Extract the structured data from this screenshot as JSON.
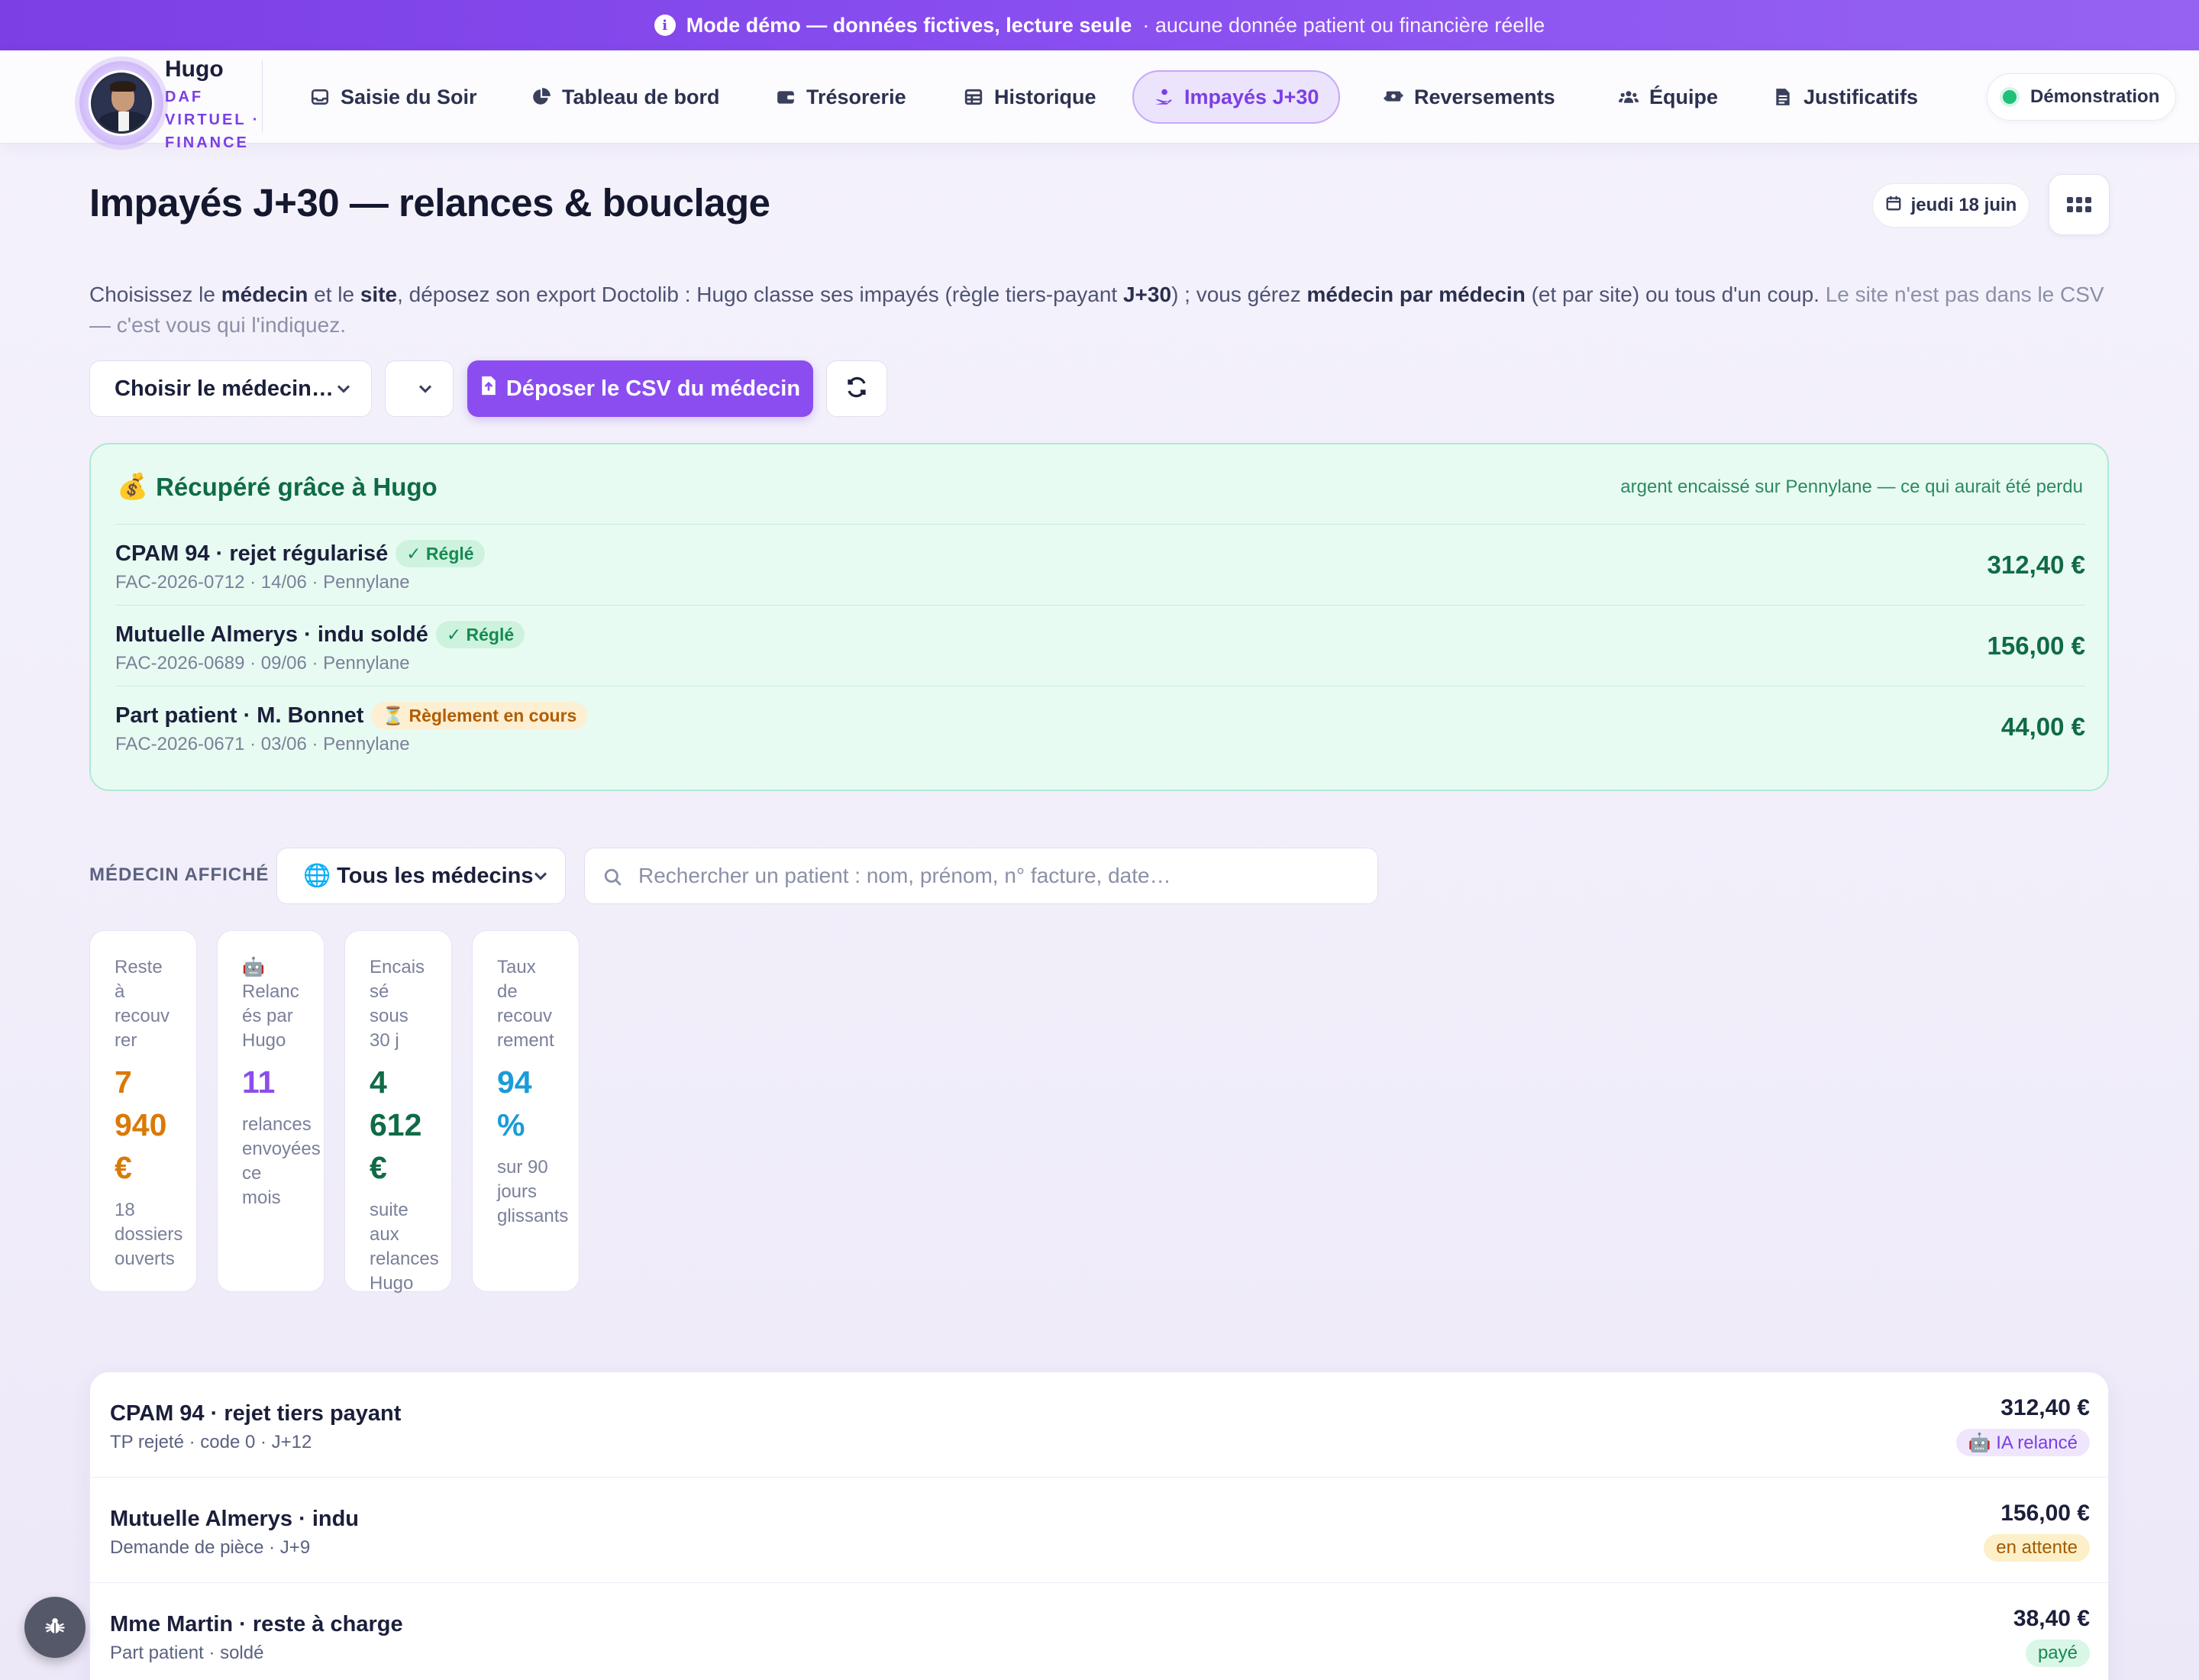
{
  "banner": {
    "title": "Mode démo — données fictives, lecture seule",
    "subtitle": "· aucune donnée patient ou financière réelle",
    "icon": "info-icon"
  },
  "brand": {
    "name": "Hugo",
    "tagline": "DAF VIRTUEL · FINANCE"
  },
  "nav": {
    "items": [
      {
        "label": "Saisie du Soir",
        "icon": "inbox-icon"
      },
      {
        "label": "Tableau de bord",
        "icon": "pie-chart-icon"
      },
      {
        "label": "Trésorerie",
        "icon": "wallet-icon"
      },
      {
        "label": "Historique",
        "icon": "table-icon"
      },
      {
        "label": "Impayés J+30",
        "icon": "hand-coins-icon",
        "active": true
      },
      {
        "label": "Reversements",
        "icon": "money-transfer-icon"
      },
      {
        "label": "Équipe",
        "icon": "users-icon"
      },
      {
        "label": "Justificatifs",
        "icon": "document-icon"
      }
    ],
    "mode_pill": "Démonstration"
  },
  "header": {
    "title": "Impayés J+30 — relances & bouclage",
    "date": "jeudi 18 juin"
  },
  "intro": {
    "p1": "Choisissez le ",
    "b1": "médecin",
    "p2": " et le ",
    "b2": "site",
    "p3": ", déposez son export Doctolib : Hugo classe ses impayés (règle tiers-payant ",
    "b3": "J+30",
    "p4": ") ; vous gérez ",
    "b4": "médecin par médecin",
    "p5": " (et par site) ou tous d'un coup. ",
    "muted": "Le site n'est pas dans le CSV — c'est vous qui l'indiquez."
  },
  "controls": {
    "doctor_select": "Choisir le médecin…",
    "site_select": "",
    "upload_button": "Déposer le CSV du médecin"
  },
  "recovered": {
    "title": "Récupéré grâce à Hugo",
    "title_emoji": "💰",
    "note": "argent encaissé sur Pennylane — ce qui aurait été perdu",
    "rows": [
      {
        "title": "CPAM 94 · rejet régularisé",
        "badge": "✓ Réglé",
        "badge_type": "ok",
        "sub": "FAC-2026-0712 · 14/06 · Pennylane",
        "amount": "312,40 €"
      },
      {
        "title": "Mutuelle Almerys · indu soldé",
        "badge": "✓ Réglé",
        "badge_type": "ok",
        "sub": "FAC-2026-0689 · 09/06 · Pennylane",
        "amount": "156,00 €"
      },
      {
        "title": "Part patient · M. Bonnet",
        "badge": "⏳ Règlement en cours",
        "badge_type": "pending",
        "sub": "FAC-2026-0671 · 03/06 · Pennylane",
        "amount": "44,00 €"
      }
    ]
  },
  "filter": {
    "label": "MÉDECIN AFFICHÉ",
    "doctor": "🌐 Tous les médecins",
    "search_placeholder": "Rechercher un patient : nom, prénom, n° facture, date…"
  },
  "kpis": [
    {
      "label": "Reste à recouvrer",
      "value": "7 940 €",
      "sub": "18 dossiers ouverts",
      "color": "#d97a06"
    },
    {
      "label": "🤖 Relancés par Hugo",
      "value": "11",
      "sub": "relances envoyées ce mois",
      "color": "#8b4df0"
    },
    {
      "label": "Encaissé sous 30 j",
      "value": "4 612 €",
      "sub": "suite aux relances Hugo",
      "color": "#0f6b46"
    },
    {
      "label": "Taux de recouvrement",
      "value": "94 %",
      "sub": "sur 90 jours glissants",
      "color": "#1b9bd8"
    }
  ],
  "list": [
    {
      "title": "CPAM 94 · rejet tiers payant",
      "sub": "TP rejeté · code 0 · J+12",
      "amount": "312,40 €",
      "badge": "🤖 IA relancé",
      "badge_type": "ia"
    },
    {
      "title": "Mutuelle Almerys · indu",
      "sub": "Demande de pièce · J+9",
      "amount": "156,00 €",
      "badge": "en attente",
      "badge_type": "wait"
    },
    {
      "title": "Mme Martin · reste à charge",
      "sub": "Part patient · soldé",
      "amount": "38,40 €",
      "badge": "payé",
      "badge_type": "paid"
    }
  ],
  "colors": {
    "accent": "#8b4df0",
    "success": "#0f6b46",
    "warning": "#d97a06",
    "info": "#1b9bd8"
  }
}
